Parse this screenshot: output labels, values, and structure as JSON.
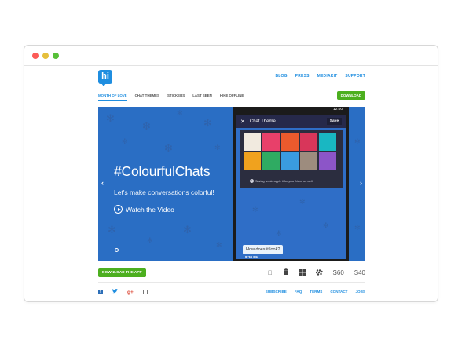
{
  "site": {
    "logo_text": "hi",
    "top_links": [
      "BLOG",
      "PRESS",
      "MEDIAKIT",
      "SUPPORT"
    ],
    "tabs": [
      "MONTH OF LOVE",
      "CHAT THEMES",
      "STICKERS",
      "LAST SEEN",
      "HIKE OFFLINE"
    ],
    "active_tab": "MONTH OF LOVE",
    "download_top": "DOWNLOAD"
  },
  "hero": {
    "title": "#ColourfulChats",
    "subtitle": "Let's make conversations colorful!",
    "watch_label": "Watch the Video",
    "background_color": "#2a6ec4",
    "phone": {
      "time": "12:00",
      "app_title": "Chat Theme",
      "save_label": "Save",
      "notice": "Saving would apply it for your friend as well.",
      "bubble_text": "How does it look?",
      "bubble_time": "8:30 PM",
      "theme_colors": [
        "#f1eadf",
        "#e8406a",
        "#ea5a2d",
        "#d8365a",
        "#19b7c2",
        "#f0a21e",
        "#2fab62",
        "#3a9be0",
        "#9d8c7e",
        "#8c55c8"
      ]
    }
  },
  "bottom": {
    "download_app": "DOWNLOAD THE APP",
    "platforms": [
      "apple-icon",
      "android-icon",
      "windows-icon",
      "blackberry-icon"
    ],
    "platform_labels": [
      "S60",
      "S40"
    ]
  },
  "footer": {
    "social_icons": [
      "facebook-icon",
      "twitter-icon",
      "google-plus-icon",
      "instagram-icon"
    ],
    "links": [
      "SUBSCRIBE",
      "FAQ",
      "TERMS",
      "CONTACT",
      "JOBS"
    ]
  }
}
